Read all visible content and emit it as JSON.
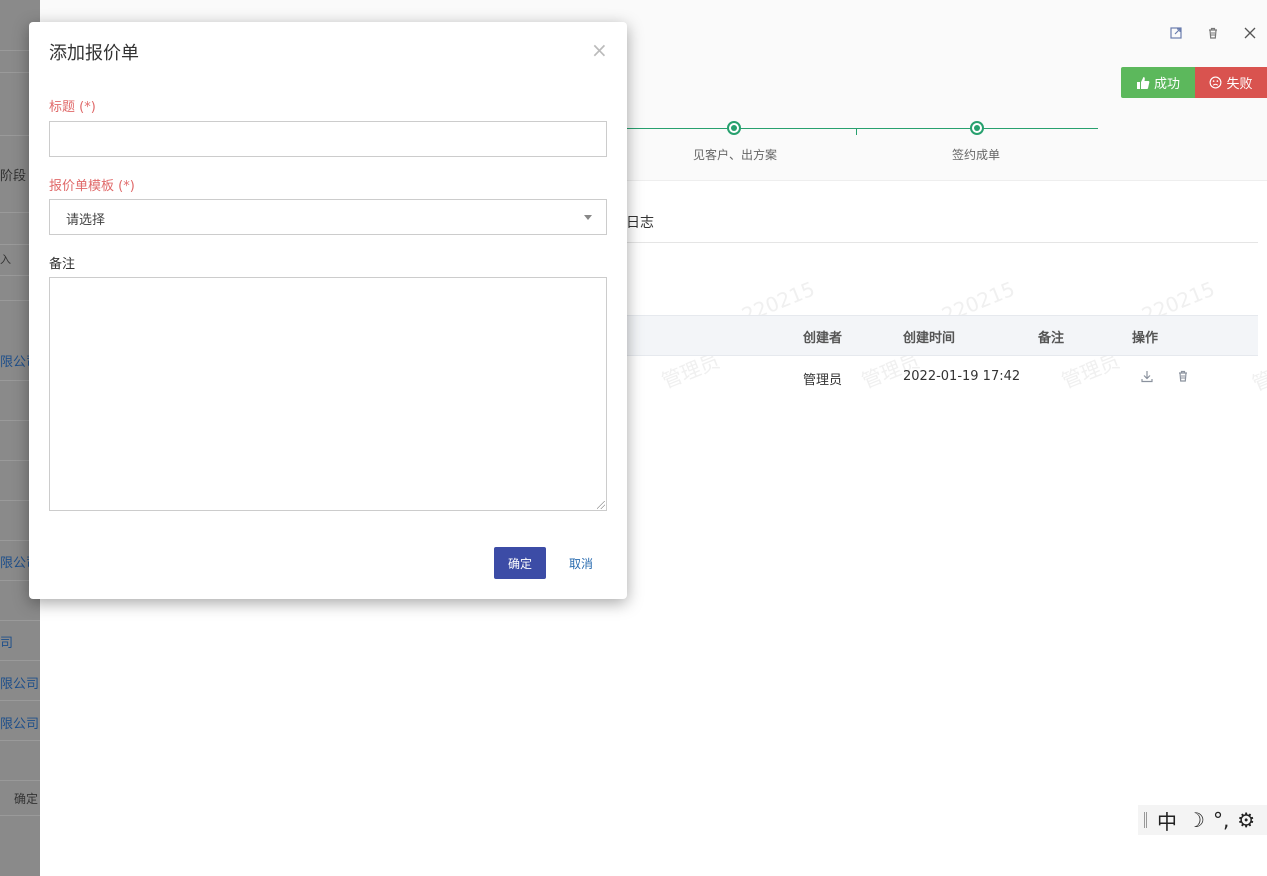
{
  "background_left": {
    "items": [
      "阶段",
      "入",
      "限公司",
      "限公司",
      "司",
      "限公司",
      "限公司",
      "确定"
    ]
  },
  "panel": {
    "header_buttons": {
      "success": "成功",
      "fail": "失败"
    },
    "stages": [
      {
        "label": "见客户、出方案"
      },
      {
        "label": "签约成单"
      }
    ],
    "tab_partial": "日志",
    "table": {
      "columns": [
        "创建者",
        "创建时间",
        "备注",
        "操作"
      ],
      "rows": [
        {
          "creator": "管理员",
          "created_at": "2022-01-19 17:42",
          "remark": ""
        }
      ]
    },
    "watermarks": [
      "220215",
      "220215",
      "220215",
      "管理员",
      "管理员",
      "管理员",
      "管"
    ]
  },
  "modal": {
    "title": "添加报价单",
    "fields": {
      "title_label": "标题 (*)",
      "title_value": "",
      "template_label": "报价单模板 (*)",
      "template_value": "请选择",
      "remark_label": "备注",
      "remark_value": ""
    },
    "confirm_label": "确定",
    "cancel_label": "取消"
  },
  "ime": {
    "lang": "中",
    "items": [
      "☽",
      "°,",
      "⚙"
    ]
  },
  "colors": {
    "success": "#5cb85c",
    "fail": "#d9534f",
    "primary": "#3c4ca6",
    "required": "#e06a6a",
    "stage": "#27a06e"
  }
}
